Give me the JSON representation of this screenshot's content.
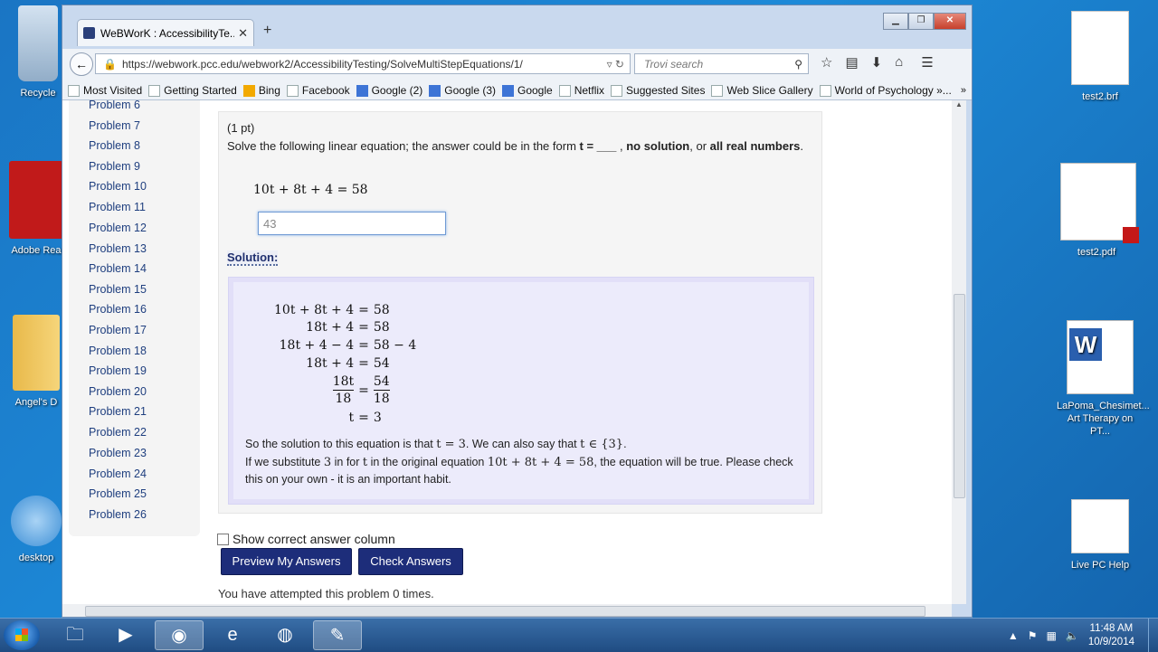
{
  "desktop": {
    "left_icons": [
      {
        "label": "Recycle",
        "icon": "recycle-bin-icon"
      },
      {
        "label": "Adobe Rea",
        "icon": "adobe-reader-icon"
      },
      {
        "label": "Angel's D",
        "icon": "folder-icon"
      },
      {
        "label": "desktop",
        "icon": "gear-icon"
      }
    ],
    "right_icons": [
      {
        "label": "test2.brf",
        "icon": "blank-file-icon"
      },
      {
        "label": "test2.pdf",
        "icon": "pdf-file-icon"
      },
      {
        "label1": "LaPoma_Chesimet...",
        "label2": "Art Therapy on PT...",
        "icon": "word-doc-icon"
      },
      {
        "label": "Live PC Help",
        "icon": "shortcut-file-icon"
      }
    ]
  },
  "browser": {
    "tab_title": "WeBWorK : AccessibilityTe...",
    "url": "https://webwork.pcc.edu/webwork2/AccessibilityTesting/SolveMultiStepEquations/1/",
    "search_placeholder": "Trovi search",
    "bookmarks": [
      "Most Visited",
      "Getting Started",
      "Bing",
      "Facebook",
      "Google (2)",
      "Google (3)",
      "Google",
      "Netflix",
      "Suggested Sites",
      "Web Slice Gallery",
      "World of Psychology »..."
    ]
  },
  "sidebar": {
    "problems": [
      "Problem 6",
      "Problem 7",
      "Problem 8",
      "Problem 9",
      "Problem 10",
      "Problem 11",
      "Problem 12",
      "Problem 13",
      "Problem 14",
      "Problem 15",
      "Problem 16",
      "Problem 17",
      "Problem 18",
      "Problem 19",
      "Problem 20",
      "Problem 21",
      "Problem 22",
      "Problem 23",
      "Problem 24",
      "Problem 25",
      "Problem 26"
    ]
  },
  "problem": {
    "points": "(1 pt)",
    "statement_prefix": "Solve the following linear equation; the answer could be in the form ",
    "t_form": "t = ___",
    "sep1": " , ",
    "no_solution": "no solution",
    "sep2": ", or ",
    "all_real": "all real numbers",
    "period": ".",
    "equation": "10t + 8t + 4 = 58",
    "answer_value": "43",
    "solution_heading": "Solution:",
    "steps": [
      {
        "l": "10t + 8t + 4",
        "r": "58"
      },
      {
        "l": "18t + 4",
        "r": "58"
      },
      {
        "l": "18t + 4 − 4",
        "r": "58 − 4"
      },
      {
        "l": "18t + 4",
        "r": "54"
      },
      {
        "l_num": "18t",
        "l_den": "18",
        "r_num": "54",
        "r_den": "18"
      },
      {
        "l": "t",
        "r": "3"
      }
    ],
    "sol_line1_a": "So the solution to this equation is that ",
    "sol_line1_m1": "t = 3",
    "sol_line1_b": ". We can also say that ",
    "sol_line1_m2": "t ∈ {3}",
    "sol_line1_c": ".",
    "sol_line2_a": "If we substitute ",
    "sol_line2_m1": "3",
    "sol_line2_b": " in for ",
    "sol_line2_m2": "t",
    "sol_line2_c": " in the original equation ",
    "sol_line2_m3": "10t + 8t + 4 = 58",
    "sol_line2_d": ", the equation will be true. Please check this on your own - it is an important habit.",
    "show_correct_label": "Show correct answer column",
    "preview_button": "Preview My Answers",
    "check_button": "Check Answers",
    "attempts_text": "You have attempted this problem 0 times."
  },
  "taskbar": {
    "time": "11:48 AM",
    "date": "10/9/2014"
  },
  "colors": {
    "button_bg": "#1d2d7a",
    "solution_bg": "#ecebfb",
    "link": "#1f3f7f"
  }
}
